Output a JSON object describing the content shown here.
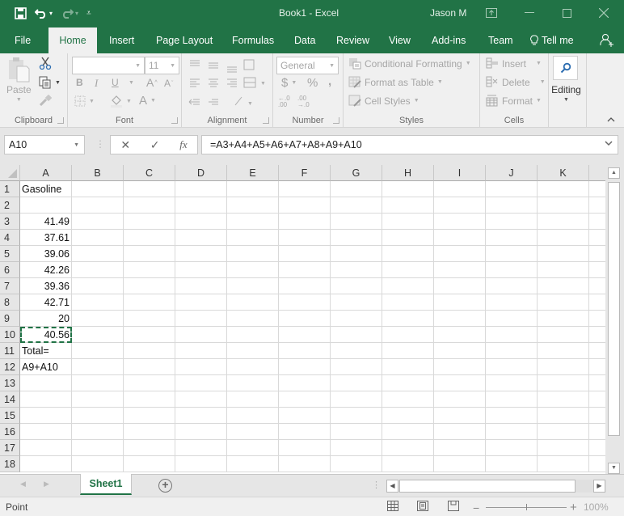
{
  "window": {
    "title": "Book1  -  Excel",
    "user": "Jason M",
    "accent_color": "#217346"
  },
  "qat": {
    "save_icon": "save-icon",
    "undo_icon": "undo-icon",
    "redo_icon": "redo-icon",
    "customize_icon": "customize-qat-icon"
  },
  "tabs": [
    {
      "label": "File",
      "active": false
    },
    {
      "label": "Home",
      "active": true
    },
    {
      "label": "Insert",
      "active": false
    },
    {
      "label": "Page Layout",
      "active": false
    },
    {
      "label": "Formulas",
      "active": false
    },
    {
      "label": "Data",
      "active": false
    },
    {
      "label": "Review",
      "active": false
    },
    {
      "label": "View",
      "active": false
    },
    {
      "label": "Add-ins",
      "active": false
    },
    {
      "label": "Team",
      "active": false
    }
  ],
  "tell_me": "Tell me",
  "ribbon": {
    "clipboard": {
      "label": "Clipboard",
      "paste": "Paste"
    },
    "font": {
      "label": "Font",
      "font_name": "",
      "font_size": "11",
      "bold": "B",
      "italic": "I",
      "underline": "U",
      "grow": "A",
      "shrink": "A",
      "font_color": "A"
    },
    "alignment": {
      "label": "Alignment"
    },
    "number": {
      "label": "Number",
      "format": "General",
      "currency": "$",
      "percent": "%",
      "comma": ",",
      "inc_decimal": "←.0\n.00",
      "dec_decimal": ".00\n→.0"
    },
    "styles": {
      "label": "Styles",
      "conditional": "Conditional Formatting",
      "format_table": "Format as Table",
      "cell_styles": "Cell Styles"
    },
    "cells": {
      "label": "Cells",
      "insert": "Insert",
      "delete": "Delete",
      "format": "Format"
    },
    "editing": {
      "label": "Editing"
    }
  },
  "formula_bar": {
    "name_box": "A10",
    "cancel": "✕",
    "enter": "✓",
    "fx": "fx",
    "formula": "=A3+A4+A5+A6+A7+A8+A9+A10"
  },
  "grid": {
    "columns": [
      "A",
      "B",
      "C",
      "D",
      "E",
      "F",
      "G",
      "H",
      "I",
      "J",
      "K"
    ],
    "rows": [
      "1",
      "2",
      "3",
      "4",
      "5",
      "6",
      "7",
      "8",
      "9",
      "10",
      "11",
      "12",
      "13",
      "14",
      "15",
      "16",
      "17",
      "18"
    ],
    "cells": {
      "A1": "Gasoline",
      "A3": "41.49",
      "A4": "37.61",
      "A5": "39.06",
      "A6": "42.26",
      "A7": "39.36",
      "A8": "42.71",
      "A9": "20",
      "A10": "40.56",
      "A11": "Total=",
      "A12": "A9+A10"
    },
    "marquee_cell": "A10"
  },
  "sheets": {
    "tabs": [
      "Sheet1"
    ],
    "active": "Sheet1"
  },
  "status": {
    "mode": "Point",
    "zoom": "100%"
  }
}
